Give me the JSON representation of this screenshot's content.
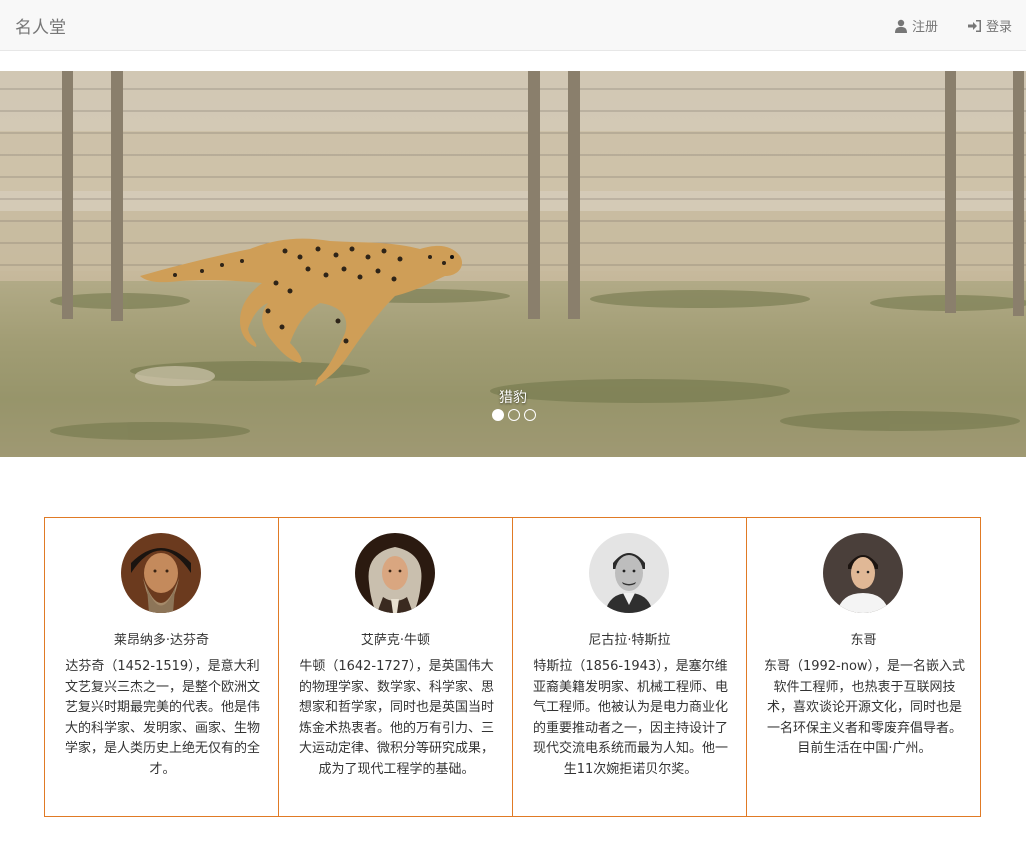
{
  "navbar": {
    "brand": "名人堂",
    "register_label": "注册",
    "login_label": "登录"
  },
  "carousel": {
    "caption": "猎豹",
    "slide_count": 3,
    "active_index": 0
  },
  "cards": [
    {
      "name": "莱昂纳多·达芬奇",
      "description": "达芬奇（1452-1519），是意大利文艺复兴三杰之一，是整个欧洲文艺复兴时期最完美的代表。他是伟大的科学家、发明家、画家、生物学家，是人类历史上绝无仅有的全才。"
    },
    {
      "name": "艾萨克·牛顿",
      "description": "牛顿（1642-1727），是英国伟大的物理学家、数学家、科学家、思想家和哲学家，同时也是英国当时炼金术热衷者。他的万有引力、三大运动定律、微积分等研究成果，成为了现代工程学的基础。"
    },
    {
      "name": "尼古拉·特斯拉",
      "description": "特斯拉（1856-1943），是塞尔维亚裔美籍发明家、机械工程师、电气工程师。他被认为是电力商业化的重要推动者之一，因主持设计了现代交流电系统而最为人知。他一生11次婉拒诺贝尔奖。"
    },
    {
      "name": "东哥",
      "description": "东哥（1992-now），是一名嵌入式软件工程师，也热衷于互联网技术，喜欢谈论开源文化，同时也是一名环保主义者和零废弃倡导者。目前生活在中国·广州。"
    }
  ],
  "colors": {
    "card_border": "#e07a25",
    "navbar_bg": "#f8f8f8"
  }
}
